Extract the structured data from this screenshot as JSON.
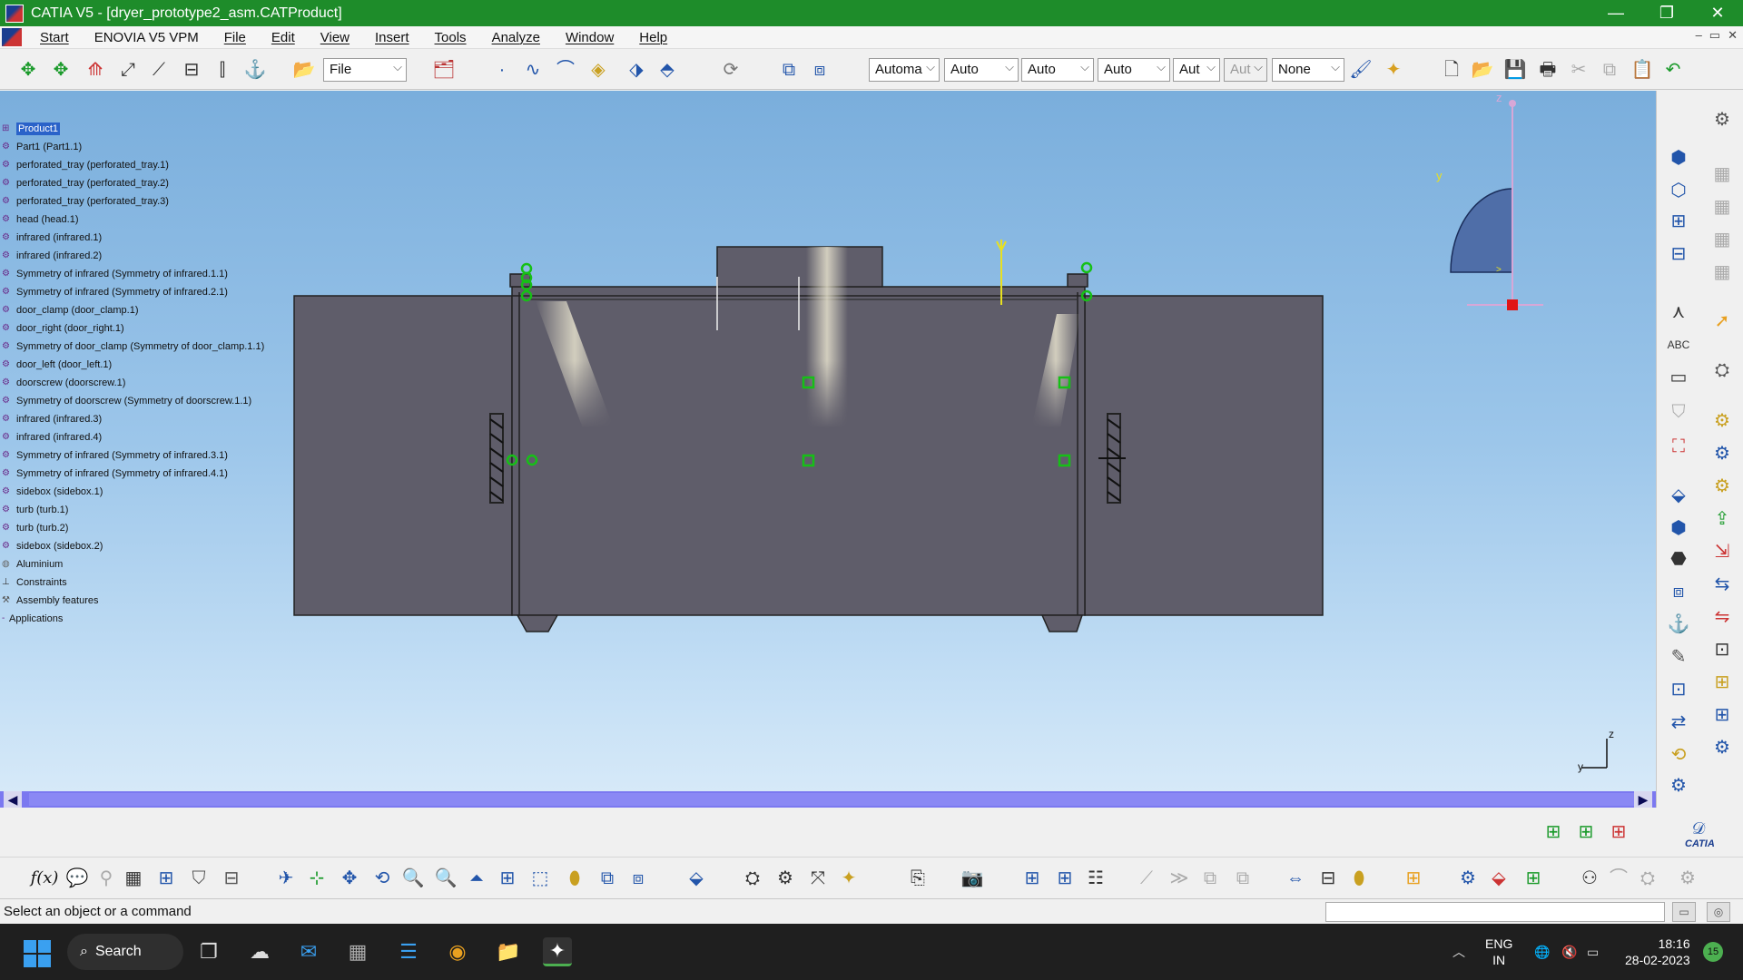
{
  "window": {
    "title": "CATIA V5 - [dryer_prototype2_asm.CATProduct]",
    "controls": {
      "minimize": "—",
      "restore": "❐",
      "close": "✕"
    }
  },
  "menu": {
    "items": [
      "Start",
      "ENOVIA V5 VPM",
      "File",
      "Edit",
      "View",
      "Insert",
      "Tools",
      "Analyze",
      "Window",
      "Help"
    ],
    "doc_controls": [
      "–",
      "▭",
      "✕"
    ]
  },
  "toolbar": {
    "file_combo": "File",
    "combos": [
      "Automa",
      "Auto",
      "Auto",
      "Auto",
      "Aut",
      "Aut",
      "None"
    ]
  },
  "tree": {
    "items": [
      "Product1",
      "Part1 (Part1.1)",
      "perforated_tray (perforated_tray.1)",
      "perforated_tray (perforated_tray.2)",
      "perforated_tray (perforated_tray.3)",
      "head (head.1)",
      "infrared (infrared.1)",
      "infrared (infrared.2)",
      "Symmetry of infrared (Symmetry of infrared.1.1)",
      "Symmetry of infrared (Symmetry of infrared.2.1)",
      "door_clamp (door_clamp.1)",
      "door_right (door_right.1)",
      "Symmetry of door_clamp (Symmetry of door_clamp.1.1)",
      "door_left (door_left.1)",
      "doorscrew (doorscrew.1)",
      "Symmetry of doorscrew (Symmetry of doorscrew.1.1)",
      "infrared (infrared.3)",
      "infrared (infrared.4)",
      "Symmetry of infrared (Symmetry of infrared.3.1)",
      "Symmetry of infrared (Symmetry of infrared.4.1)",
      "sidebox (sidebox.1)",
      "turb (turb.1)",
      "turb (turb.2)",
      "sidebox (sidebox.2)",
      "Aluminium",
      "Constraints",
      "Assembly features",
      "Applications"
    ]
  },
  "compass": {
    "z": "z",
    "y": "y"
  },
  "axis": {
    "z": "z",
    "y": "y"
  },
  "brand": "CATIA",
  "status": {
    "message": "Select an object or a command"
  },
  "taskbar": {
    "search": "Search",
    "lang": "ENG",
    "region": "IN",
    "time": "18:16",
    "date": "28-02-2023",
    "notifications": "15"
  },
  "colors": {
    "titlebar": "#1e8c2a",
    "viewport_top": "#7aaedc",
    "model_body": "#5f5d6a",
    "highlight": "#2a62c9"
  }
}
